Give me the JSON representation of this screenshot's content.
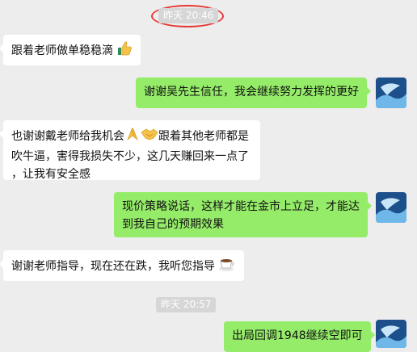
{
  "timestamps": {
    "first": "昨天 20:46",
    "second": "昨天 20:57"
  },
  "colors": {
    "accent_ring": "#e53935",
    "bubble_right": "#95ec69",
    "bubble_left": "#ffffff",
    "background": "#ededed"
  },
  "messages": [
    {
      "side": "left",
      "text": "跟着老师做单稳稳滴",
      "emoji": "thumbs-up"
    },
    {
      "side": "right",
      "text": "谢谢吴先生信任，我会继续努力发挥的更好"
    },
    {
      "side": "left",
      "part1": "也谢谢戴老师给我机会",
      "emoji1": "bowing-hands",
      "emoji2": "handshake",
      "part2": "跟着其他老师都是",
      "line2": "吹牛逼，害得我损失不少，这几天赚回来一点了",
      "line3": "，让我有安全感"
    },
    {
      "side": "right",
      "line1": "现价策略说话，这样才能在金市上立足，才能达",
      "line2": "到我自己的预期效果"
    },
    {
      "side": "left",
      "text": "谢谢老师指导，现在还在跌，我听您指导",
      "emoji": "coffee-cup"
    },
    {
      "side": "right",
      "text": "出局回调1948继续空即可"
    }
  ]
}
